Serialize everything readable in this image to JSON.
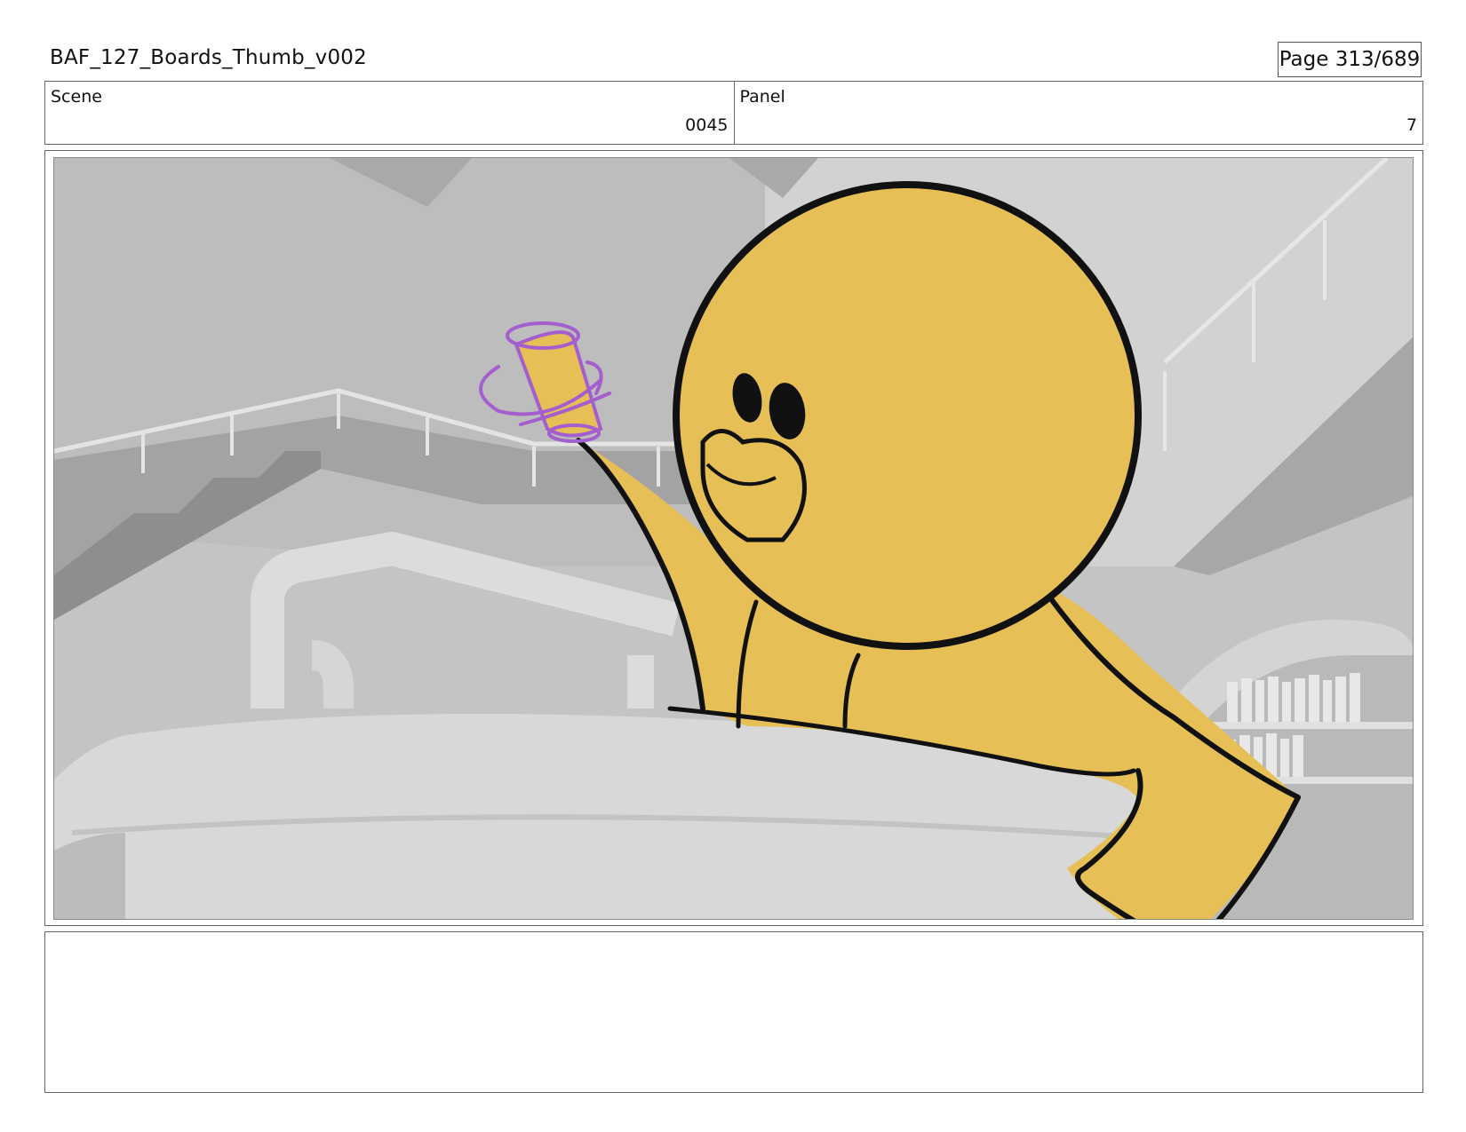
{
  "header": {
    "file_title": "BAF_127_Boards_Thumb_v002",
    "page_label": "Page 313/689"
  },
  "info": {
    "scene_label": "Scene",
    "scene_value": "0045",
    "panel_label": "Panel",
    "panel_value": "7"
  },
  "artwork": {
    "description_icon": "storyboard-frame",
    "character_color": "#e6c056",
    "outline_color": "#111111",
    "pipe_sketch_color": "#a45fcf",
    "background_tone": "#c9c9c9"
  },
  "notes": {
    "text": ""
  }
}
